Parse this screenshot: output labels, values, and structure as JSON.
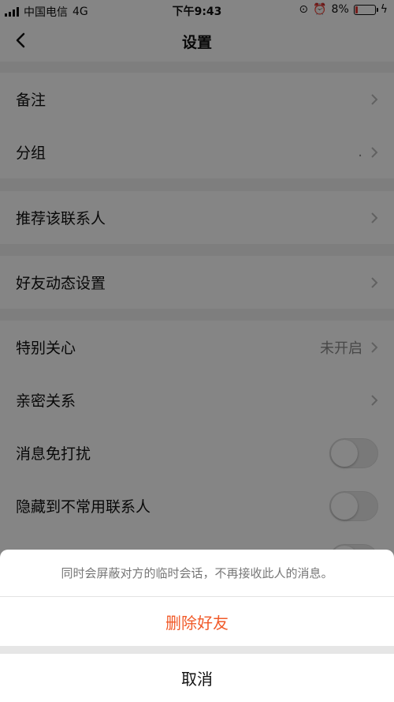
{
  "status_bar": {
    "carrier": "中国电信",
    "network": "4G",
    "time": "下午9:43",
    "battery": "8%",
    "battery_level": 0.08
  },
  "header": {
    "title": "设置",
    "back_icon": "chevron-left-icon"
  },
  "sections": [
    {
      "rows": [
        {
          "label": "备注",
          "value": ""
        },
        {
          "label": "分组",
          "value": "."
        }
      ]
    },
    {
      "rows": [
        {
          "label": "推荐该联系人",
          "value": ""
        }
      ]
    },
    {
      "rows": [
        {
          "label": "好友动态设置",
          "value": ""
        }
      ]
    },
    {
      "rows": [
        {
          "label": "特别关心",
          "value": "未开启"
        },
        {
          "label": "亲密关系",
          "value": ""
        },
        {
          "label": "消息免打扰",
          "toggle": false
        },
        {
          "label": "隐藏到不常用联系人",
          "toggle": false
        }
      ]
    }
  ],
  "action_sheet": {
    "message": "同时会屏蔽对方的临时会话，不再接收此人的消息。",
    "delete_label": "删除好友",
    "cancel_label": "取消"
  },
  "colors": {
    "danger": "#f15a29",
    "overlay": "rgba(0,0,0,0.48)"
  }
}
